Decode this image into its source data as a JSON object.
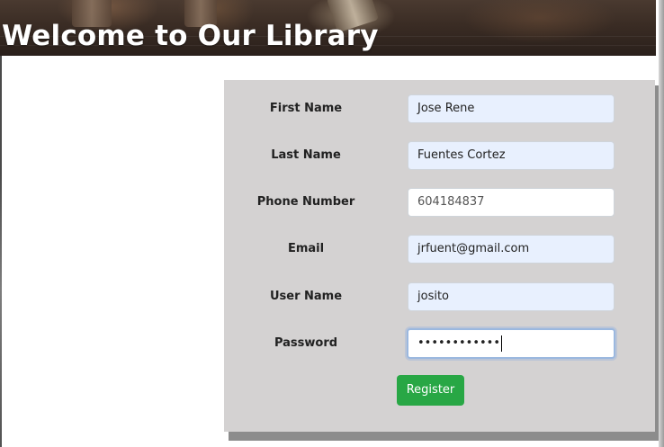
{
  "header": {
    "title": "Welcome to Our Library"
  },
  "form": {
    "fields": [
      {
        "label": "First Name",
        "value": "Jose Rene",
        "autofilled": true
      },
      {
        "label": "Last Name",
        "value": "Fuentes Cortez",
        "autofilled": true
      },
      {
        "label": "Phone Number",
        "value": "604184837",
        "autofilled": false
      },
      {
        "label": "Email",
        "value": "jrfuent@gmail.com",
        "autofilled": true
      },
      {
        "label": "User Name",
        "value": "josito",
        "autofilled": true
      },
      {
        "label": "Password",
        "value": "••••••••••••",
        "focused": true
      }
    ],
    "submit_label": "Register"
  },
  "colors": {
    "panel_bg": "#d4d2d2",
    "autofill_bg": "#e8f0fe",
    "button_bg": "#28a745"
  }
}
